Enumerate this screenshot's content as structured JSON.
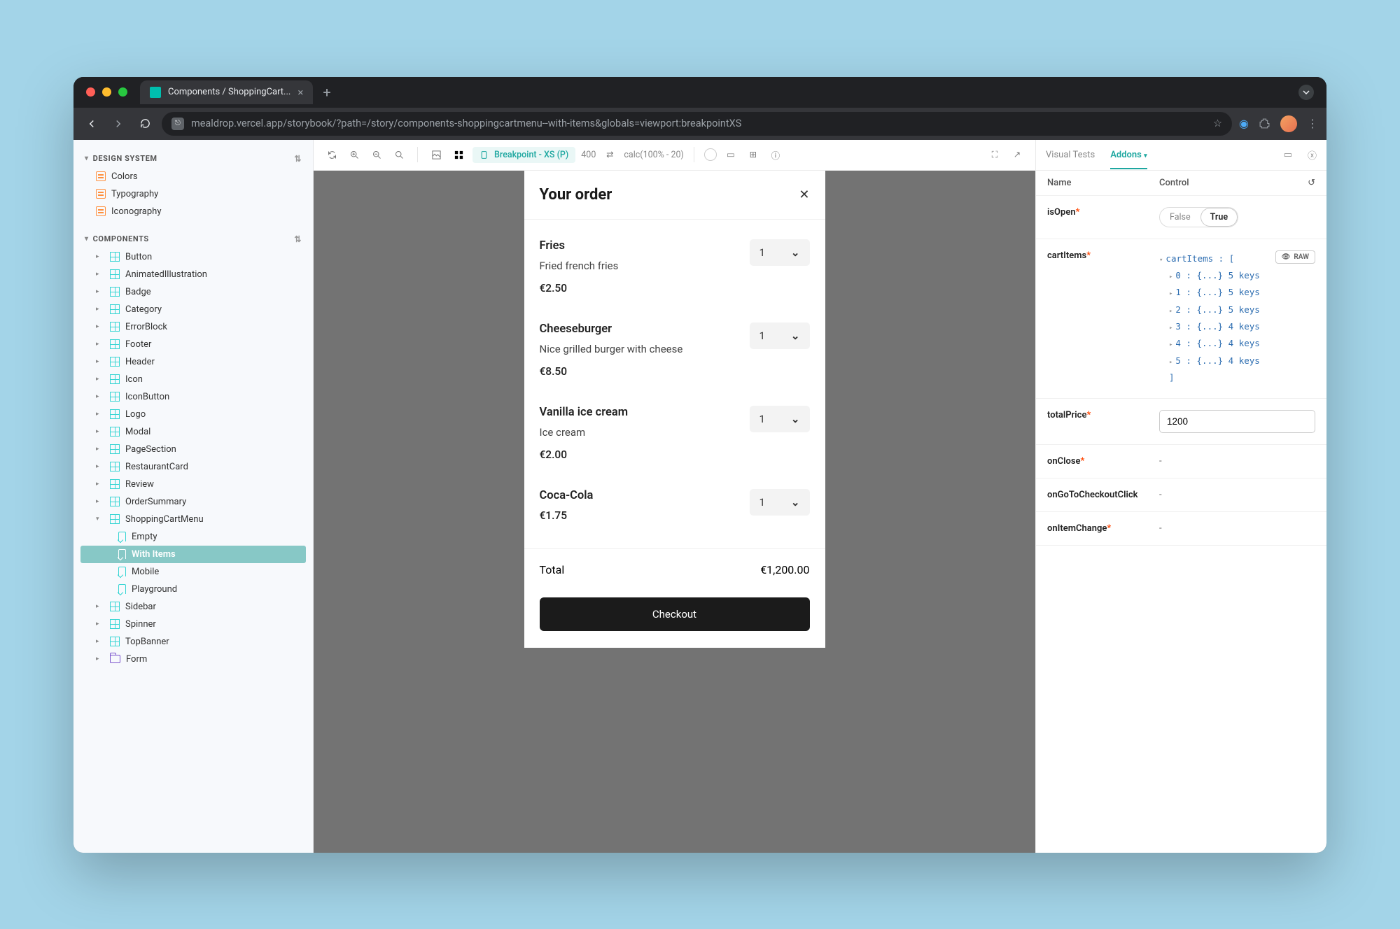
{
  "browser": {
    "tab_title": "Components / ShoppingCart...",
    "url": "mealdrop.vercel.app/storybook/?path=/story/components-shoppingcartmenu--with-items&globals=viewport:breakpointXS"
  },
  "sidebar": {
    "sections": {
      "design_system": {
        "title": "DESIGN SYSTEM",
        "items": [
          "Colors",
          "Typography",
          "Iconography"
        ]
      },
      "components": {
        "title": "COMPONENTS",
        "items": [
          "Button",
          "AnimatedIllustration",
          "Badge",
          "Category",
          "ErrorBlock",
          "Footer",
          "Header",
          "Icon",
          "IconButton",
          "Logo",
          "Modal",
          "PageSection",
          "RestaurantCard",
          "Review",
          "OrderSummary"
        ],
        "shopping_cart": {
          "label": "ShoppingCartMenu",
          "children": [
            "Empty",
            "With Items",
            "Mobile",
            "Playground"
          ],
          "selected": "With Items"
        },
        "after": [
          "Sidebar",
          "Spinner",
          "TopBanner"
        ],
        "folders": [
          "Form"
        ]
      }
    }
  },
  "toolbar": {
    "viewport_label": "Breakpoint - XS (P)",
    "width": "400",
    "dim": "calc(100% - 20)"
  },
  "cart": {
    "title": "Your order",
    "items": [
      {
        "name": "Fries",
        "desc": "Fried french fries",
        "price": "€2.50",
        "qty": "1"
      },
      {
        "name": "Cheeseburger",
        "desc": "Nice grilled burger with cheese",
        "price": "€8.50",
        "qty": "1"
      },
      {
        "name": "Vanilla ice cream",
        "desc": "Ice cream",
        "price": "€2.00",
        "qty": "1"
      },
      {
        "name": "Coca-Cola",
        "desc": "",
        "price": "€1.75",
        "qty": "1"
      }
    ],
    "total_label": "Total",
    "total_value": "€1,200.00",
    "checkout_label": "Checkout"
  },
  "addons": {
    "tabs": {
      "visual": "Visual Tests",
      "controls": "Addons"
    },
    "head": {
      "name": "Name",
      "control": "Control"
    },
    "controls": {
      "isOpen": {
        "label": "isOpen",
        "false": "False",
        "true": "True"
      },
      "cartItems": {
        "label": "cartItems",
        "root": "cartItems : [",
        "rows": [
          "0 : {...} 5 keys",
          "1 : {...} 5 keys",
          "2 : {...} 5 keys",
          "3 : {...} 4 keys",
          "4 : {...} 4 keys",
          "5 : {...} 4 keys"
        ],
        "close": "]",
        "raw": "RAW"
      },
      "totalPrice": {
        "label": "totalPrice",
        "value": "1200"
      },
      "onClose": {
        "label": "onClose",
        "value": "-"
      },
      "onGoToCheckoutClick": {
        "label": "onGoToCheckoutClick",
        "value": "-"
      },
      "onItemChange": {
        "label": "onItemChange",
        "value": "-"
      }
    }
  }
}
